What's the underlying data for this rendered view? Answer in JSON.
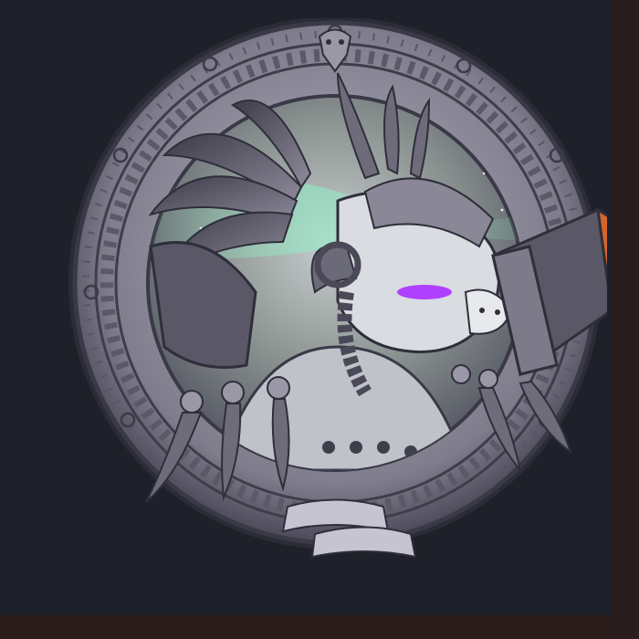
{
  "artwork": {
    "subject": "bull-spirit-medallion",
    "colors": {
      "background": "#1e2129",
      "rim": "#8a8797",
      "rim_dark": "#4a4756",
      "sky": "#a8b3b0",
      "aurora": "#8ff0c8",
      "magenta_accent": "#b040ff",
      "orange_accent": "#d4662a",
      "fur": "#d9dce0",
      "horn": "#6a6a78"
    }
  }
}
